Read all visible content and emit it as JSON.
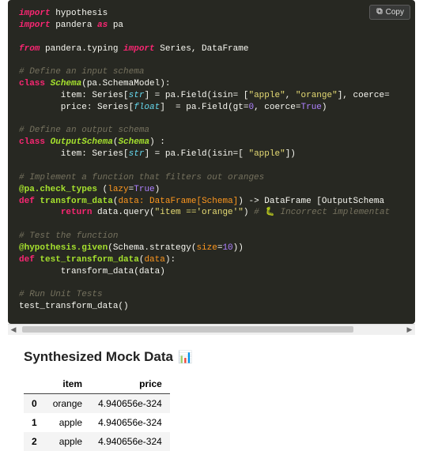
{
  "copy_label": "Copy",
  "code": {
    "l1": {
      "a": "import",
      "b": " hypothesis"
    },
    "l2": {
      "a": "import",
      "b": " pandera ",
      "c": "as",
      "d": " pa"
    },
    "l3": {
      "a": "from",
      "b": " pandera.typing ",
      "c": "import",
      "d": " Series, DataFrame"
    },
    "l4": "# Define an input schema",
    "l5": {
      "a": "class",
      "b": " ",
      "c": "Schema",
      "d": "(pa.SchemaModel):"
    },
    "l6": {
      "a": "        item: Series[",
      "b": "str",
      "c": "] = pa.Field(isin= [",
      "d": "\"apple\"",
      "e": ", ",
      "f": "\"orange\"",
      "g": "], coerce="
    },
    "l7": {
      "a": "        price: Series[",
      "b": "float",
      "c": "]  = pa.Field(gt=",
      "d": "0",
      "e": ", coerce=",
      "f": "True",
      "g": ")"
    },
    "l8": "# Define an output schema",
    "l9": {
      "a": "class",
      "b": " ",
      "c": "OutputSchema",
      "d": "(",
      "e": "Schema",
      "f": ") :"
    },
    "l10": {
      "a": "        item: Series[",
      "b": "str",
      "c": "] = pa.Field(isin=[ ",
      "d": "\"apple\"",
      "e": "])"
    },
    "l11": "# Implement a function that filters out oranges",
    "l12": {
      "a": "@pa.check_types",
      "b": " (",
      "c": "lazy",
      "d": "=",
      "e": "True",
      "f": ")"
    },
    "l13": {
      "a": "def",
      "b": " ",
      "c": "transform_data",
      "d": "(",
      "e": "data: DataFrame[Schema]",
      "f": ") -> DataFrame [OutputSchema"
    },
    "l14": {
      "a": "        ",
      "b": "return",
      "c": " data.query(",
      "d": "\"item =='orange'\"",
      "e": ") ",
      "f": "# 🐛 Incorrect implementat"
    },
    "l15": "# Test the function",
    "l16": {
      "a": "@hypothesis.given",
      "b": "(Schema.strategy(",
      "c": "size",
      "d": "=",
      "e": "10",
      "f": "))"
    },
    "l17": {
      "a": "def",
      "b": " ",
      "c": "test_transform_data",
      "d": "(",
      "e": "data",
      "f": "):"
    },
    "l18": "        transform_data(data)",
    "l19": "# Run Unit Tests",
    "l20": "test_transform_data()"
  },
  "section_heading": "Synthesized Mock Data",
  "section_emoji": "📊",
  "table": {
    "headers": {
      "c0": "",
      "c1": "item",
      "c2": "price"
    },
    "rows": [
      {
        "idx": "0",
        "item": "orange",
        "price": "4.940656e-324"
      },
      {
        "idx": "1",
        "item": "apple",
        "price": "4.940656e-324"
      },
      {
        "idx": "2",
        "item": "apple",
        "price": "4.940656e-324"
      }
    ]
  }
}
